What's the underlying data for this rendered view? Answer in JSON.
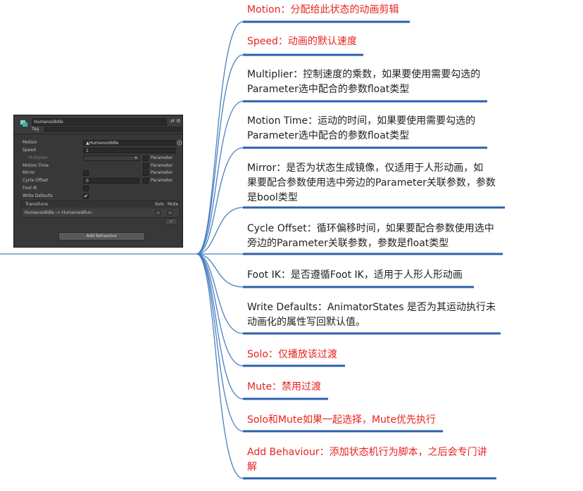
{
  "inspector": {
    "state_name": "HumanoidIdle",
    "tag_label": "Tag",
    "header_icons": "⇄ ⚙",
    "motion_label": "Motion",
    "motion_value": "▲HumanoidIdle",
    "speed_label": "Speed",
    "speed_value": "1",
    "multiplier_label": "Multiplier",
    "motion_time_label": "Motion Time",
    "mirror_label": "Mirror",
    "cycle_offset_label": "Cycle Offset",
    "cycle_offset_value": "0",
    "foot_ik_label": "Foot IK",
    "write_defaults_label": "Write Defaults",
    "write_defaults_check": "✔",
    "parameter_label": "Parameter",
    "transitions_label": "Transitions",
    "solo_label": "Solo",
    "mute_label": "Mute",
    "transition_row": "HumanoidIdle -> HumanoidRun",
    "minus_label": "−",
    "add_behaviour_label": "Add Behaviour"
  },
  "nodes": [
    {
      "color": "red",
      "lines": [
        "Motion：分配给此状态的动画剪辑"
      ]
    },
    {
      "color": "red",
      "lines": [
        "Speed：动画的默认速度"
      ]
    },
    {
      "color": "black",
      "lines": [
        "Multiplier：控制速度的乘数，如果要使用需要勾选的",
        "Parameter选中配合的参数float类型"
      ]
    },
    {
      "color": "black",
      "lines": [
        "Motion Time：运动的时间，如果要使用需要勾选的",
        "Parameter选中配合的参数float类型"
      ]
    },
    {
      "color": "black",
      "lines": [
        "Mirror：是否为状态生成镜像，仅适用于人形动画，如",
        "果要配合参数使用选中旁边的Parameter关联参数，参数",
        "是bool类型"
      ]
    },
    {
      "color": "black",
      "lines": [
        "Cycle Offset：循环偏移时间，如果要配合参数使用选中",
        "旁边的Parameter关联参数，参数是float类型"
      ]
    },
    {
      "color": "black",
      "lines": [
        "Foot IK：是否遵循Foot IK，适用于人形人形动画"
      ]
    },
    {
      "color": "black",
      "lines": [
        "Write Defaults：AnimatorStates 是否为其运动执行未",
        "动画化的属性写回默认值。"
      ]
    },
    {
      "color": "red",
      "lines": [
        "Solo：仅播放该过渡"
      ]
    },
    {
      "color": "red",
      "lines": [
        "Mute：禁用过渡"
      ]
    },
    {
      "color": "red",
      "lines": [
        "Solo和Mute如果一起选择，Mute优先执行"
      ]
    },
    {
      "color": "red",
      "lines": [
        "Add Behaviour：添加状态机行为脚本，之后会专门讲",
        "解"
      ]
    }
  ],
  "colors": {
    "connector": "#4a7fc1",
    "underline": "#2d5fae",
    "red_text": "#e8231f",
    "black_text": "#1f1f1f"
  }
}
